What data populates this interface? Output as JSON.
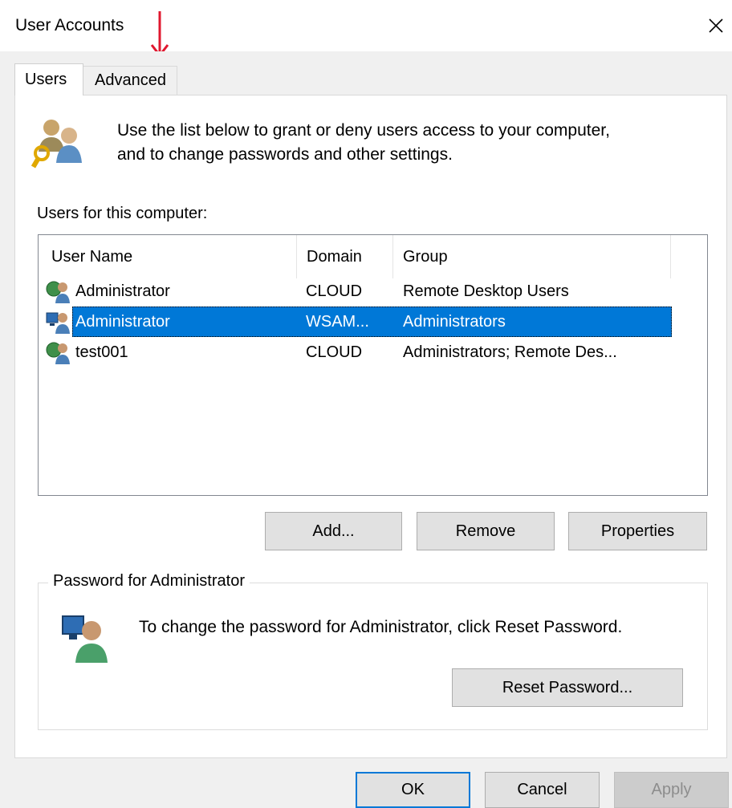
{
  "window": {
    "title": "User Accounts",
    "close_icon": "close-icon"
  },
  "annotation": {
    "arrow_color": "#e0182f",
    "arrow_icon": "down-arrow-icon"
  },
  "tabs": [
    {
      "label": "Users",
      "active": true
    },
    {
      "label": "Advanced",
      "active": false
    }
  ],
  "intro": {
    "icon": "users-key-icon",
    "text_line1": "Use the list below to grant or deny users access to your computer,",
    "text_line2": "and to change passwords and other settings."
  },
  "users_list": {
    "label": "Users for this computer:",
    "columns": [
      "User Name",
      "Domain",
      "Group"
    ],
    "rows": [
      {
        "icon": "domain-user-icon",
        "name": "Administrator",
        "domain": "CLOUD",
        "group": "Remote Desktop Users",
        "selected": false
      },
      {
        "icon": "local-user-icon",
        "name": "Administrator",
        "domain": "WSAM...",
        "group": "Administrators",
        "selected": true
      },
      {
        "icon": "domain-user-icon",
        "name": "test001",
        "domain": "CLOUD",
        "group": "Administrators; Remote Des...",
        "selected": false
      }
    ],
    "selection_color": "#0078d7"
  },
  "list_buttons": {
    "add": "Add...",
    "remove": "Remove",
    "properties": "Properties"
  },
  "password_group": {
    "title": "Password for Administrator",
    "icon": "local-user-icon",
    "text": "To change the password for Administrator, click Reset Password.",
    "reset_button": "Reset Password..."
  },
  "footer": {
    "ok": "OK",
    "cancel": "Cancel",
    "apply": "Apply"
  }
}
